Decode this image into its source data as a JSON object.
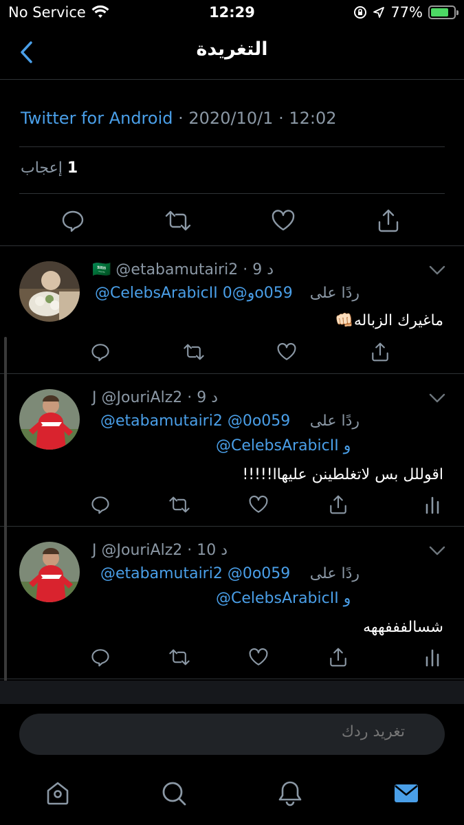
{
  "status_bar": {
    "carrier": "No Service",
    "time": "12:29",
    "battery": "77%",
    "battery_level": 0.77
  },
  "header": {
    "title": "التغريدة"
  },
  "tweet": {
    "source": "Twitter for Android",
    "date": "2020/10/1",
    "time": "12:02",
    "likes_count": "1",
    "likes_label": "إعجاب"
  },
  "replies": [
    {
      "time": "9 د",
      "handle": "@etabamutairi2",
      "flag": "🇸🇦",
      "reply_prefix": "ردًا على",
      "mentions_line1": "@CelebsArabicII و@0o059",
      "mentions_line2": "",
      "text": "ماغيرك الزباله👊🏻"
    },
    {
      "time": "9 د",
      "handle": "@JouriAlz2",
      "name": "J",
      "reply_prefix": "ردًا على",
      "mentions_line1": "@etabamutairi2 @0o059",
      "mentions_line2": "@CelebsArabicII و",
      "text": "اقوللل بس لاتغلطينن عليهاا!!!!!"
    },
    {
      "time": "10 د",
      "handle": "@JouriAlz2",
      "name": "J",
      "reply_prefix": "ردًا على",
      "mentions_line1": "@etabamutairi2 @0o059",
      "mentions_line2": "@CelebsArabicII و",
      "text": "شسالفففههه"
    }
  ],
  "compose": {
    "placeholder": "تغريد ردك"
  },
  "colors": {
    "accent": "#4a9fe8",
    "background": "#000000",
    "muted": "#8b98a5"
  }
}
